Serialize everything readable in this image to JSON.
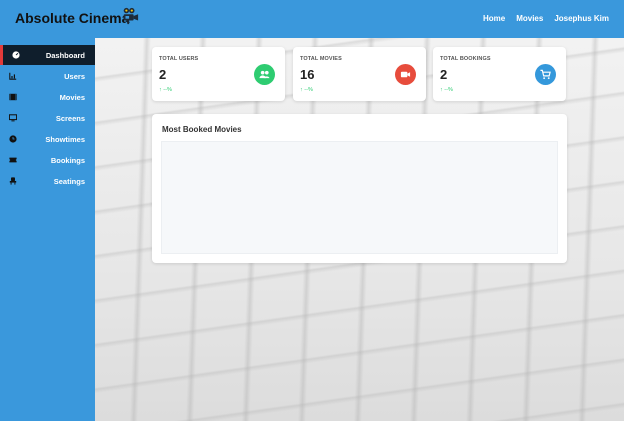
{
  "app": {
    "brand": "Absolute Cinema",
    "brand_icon": "film-camera-icon"
  },
  "nav": {
    "home": "Home",
    "movies": "Movies",
    "user": "Josephus Kim"
  },
  "sidebar": {
    "items": [
      {
        "label": "Dashboard",
        "icon": "dashboard-icon",
        "active": true
      },
      {
        "label": "Users",
        "icon": "chart-icon",
        "active": false
      },
      {
        "label": "Movies",
        "icon": "film-icon",
        "active": false
      },
      {
        "label": "Screens",
        "icon": "monitor-icon",
        "active": false
      },
      {
        "label": "Showtimes",
        "icon": "clock-icon",
        "active": false
      },
      {
        "label": "Bookings",
        "icon": "ticket-icon",
        "active": false
      },
      {
        "label": "Seatings",
        "icon": "seat-icon",
        "active": false
      }
    ]
  },
  "stats": [
    {
      "title": "TOTAL USERS",
      "value": "2",
      "delta": "↑ --%",
      "icon": "users-icon",
      "color": "#2ecc71"
    },
    {
      "title": "TOTAL MOVIES",
      "value": "16",
      "delta": "↑ --%",
      "icon": "video-camera-icon",
      "color": "#e74c3c"
    },
    {
      "title": "TOTAL BOOKINGS",
      "value": "2",
      "delta": "↑ --%",
      "icon": "cart-icon",
      "color": "#3498db"
    }
  ],
  "panel": {
    "title": "Most Booked Movies"
  },
  "colors": {
    "primary": "#3a98dc",
    "sidebar_active": "#0f1e2c",
    "active_marker": "#e23a3a"
  }
}
